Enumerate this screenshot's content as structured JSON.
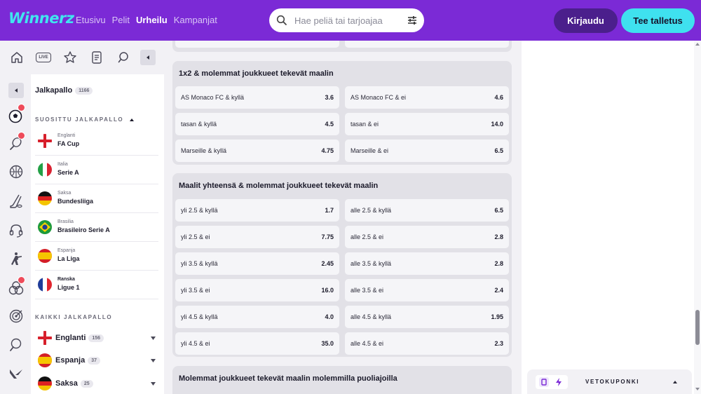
{
  "brand": {
    "logo": "Winnerz",
    "accent": "#7b2ad6",
    "cyan": "#3fe1ef"
  },
  "nav": [
    "Etusivu",
    "Pelit",
    "Urheilu",
    "Kampanjat"
  ],
  "nav_active": "Urheilu",
  "search": {
    "placeholder": "Hae peliä tai tarjoajaa"
  },
  "header_buttons": {
    "login": "Kirjaudu",
    "deposit": "Tee talletus"
  },
  "toprow": {
    "live_label": "LIVE"
  },
  "sidebar": {
    "sport": "Jalkapallo",
    "sport_count": "1166",
    "popular_title": "SUOSITTU JALKAPALLO",
    "popular": [
      {
        "country": "Englanti",
        "league": "FA Cup"
      },
      {
        "country": "Italia",
        "league": "Serie A"
      },
      {
        "country": "Saksa",
        "league": "Bundesliiga"
      },
      {
        "country": "Brasilia",
        "league": "Brasileiro Serie A"
      },
      {
        "country": "Espanja",
        "league": "La Liga"
      },
      {
        "country": "Ranska",
        "league": "Ligue 1"
      }
    ],
    "all_title": "KAIKKI JALKAPALLO",
    "all": [
      {
        "name": "Englanti",
        "count": "156"
      },
      {
        "name": "Espanja",
        "count": "37"
      },
      {
        "name": "Saksa",
        "count": "25"
      }
    ]
  },
  "rail_icons": [
    "football-icon",
    "tennis-icon",
    "basketball-icon",
    "hockey-icon",
    "esports-headset-icon",
    "shooter-icon",
    "multi-sport-icon",
    "darts-icon",
    "table-tennis-icon",
    "valorant-icon"
  ],
  "markets": [
    {
      "title": "1x2 & molemmat joukkueet tekevät maalin",
      "odds": [
        [
          "AS Monaco FC & kyllä",
          "3.6",
          "AS Monaco FC & ei",
          "4.6"
        ],
        [
          "tasan & kyllä",
          "4.5",
          "tasan & ei",
          "14.0"
        ],
        [
          "Marseille & kyllä",
          "4.75",
          "Marseille & ei",
          "6.5"
        ]
      ]
    },
    {
      "title": "Maalit yhteensä & molemmat joukkueet tekevät maalin",
      "odds": [
        [
          "yli 2.5 & kyllä",
          "1.7",
          "alle 2.5 & kyllä",
          "6.5"
        ],
        [
          "yli 2.5 & ei",
          "7.75",
          "alle 2.5 & ei",
          "2.8"
        ],
        [
          "yli 3.5 & kyllä",
          "2.45",
          "alle 3.5 & kyllä",
          "2.8"
        ],
        [
          "yli 3.5 & ei",
          "16.0",
          "alle 3.5 & ei",
          "2.4"
        ],
        [
          "yli 4.5 & kyllä",
          "4.0",
          "alle 4.5 & kyllä",
          "1.95"
        ],
        [
          "yli 4.5 & ei",
          "35.0",
          "alle 4.5 & ei",
          "2.3"
        ]
      ]
    },
    {
      "title": "Molemmat joukkueet tekevät maalin molemmilla puoliajoilla",
      "odds": []
    }
  ],
  "coupon": {
    "label": "VETOKUPONKI"
  }
}
